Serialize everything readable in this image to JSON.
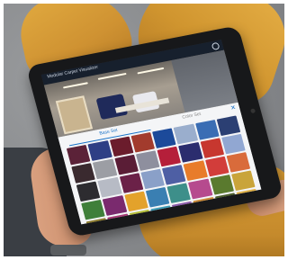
{
  "app": {
    "title": "Modular Carpet Visualizer"
  },
  "tabs": [
    {
      "label": "Base Set",
      "active": true
    },
    {
      "label": "Color Set",
      "active": false
    }
  ],
  "icons": {
    "settings": "settings-icon",
    "close": "close-icon",
    "close_glyph": "✕"
  },
  "swatches": [
    "#5b2238",
    "#2e3f85",
    "#6b1c2c",
    "#a23b2d",
    "#1c4a9a",
    "#9aaecd",
    "#3a6db4",
    "#2b3f73",
    "#3a2a2f",
    "#9c9ea4",
    "#5a1d36",
    "#8e8f9e",
    "#b51f3a",
    "#2b2d6e",
    "#c7372f",
    "#91a7d2",
    "#2d2c30",
    "#b7bbc5",
    "#6b2148",
    "#8aa0c8",
    "#4e5fa4",
    "#e87c2a",
    "#d23d3a",
    "#d96b3b",
    "#3f7f3a",
    "#7a2a6e",
    "#e3a22b",
    "#3a7fb2",
    "#3d8f8a",
    "#b64a8e",
    "#5a7a2e",
    "#c9a43a",
    "#8a7a2e",
    "#a53a75",
    "#b5be3a",
    "#3f9ab4",
    "#8a5aa8",
    "#c98a3a",
    "#4a5a2a",
    "#e0b24a"
  ]
}
